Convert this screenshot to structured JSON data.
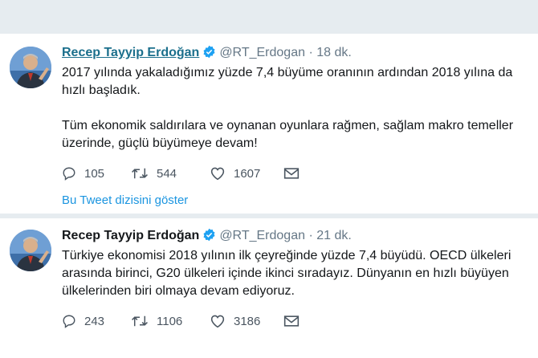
{
  "tweets": [
    {
      "name": "Recep Tayyip Erdoğan",
      "handle": "@RT_Erdogan",
      "separator": "·",
      "time": "18 dk.",
      "paragraphs": [
        "2017 yılında yakaladığımız yüzde 7,4 büyüme oranının ardından 2018 yılına da hızlı başladık.",
        "Tüm ekonomik saldırılara ve oynanan oyunlara rağmen, sağlam makro temeller üzerinde, güçlü büyümeye devam!"
      ],
      "replies": "105",
      "retweets": "544",
      "likes": "1607",
      "show_thread": "Bu Tweet dizisini göster"
    },
    {
      "name": "Recep Tayyip Erdoğan",
      "handle": "@RT_Erdogan",
      "separator": "·",
      "time": "21 dk.",
      "paragraphs": [
        "Türkiye ekonomisi 2018 yılının ilk çeyreğinde yüzde 7,4 büyüdü. OECD ülkeleri arasında birinci, G20 ülkeleri içinde ikinci sıradayız. Dünyanın en hızlı büyüyen ülkelerinden biri olmaya devam ediyoruz."
      ],
      "replies": "243",
      "retweets": "1106",
      "likes": "3186"
    }
  ],
  "icons": {
    "verified": "verified-badge-icon",
    "reply": "reply-icon",
    "retweet": "retweet-icon",
    "like": "heart-icon",
    "message": "envelope-icon"
  },
  "colors": {
    "background": "#e6ecf0",
    "link": "#1b95e0",
    "verified": "#1da1f2",
    "muted": "#657786"
  }
}
